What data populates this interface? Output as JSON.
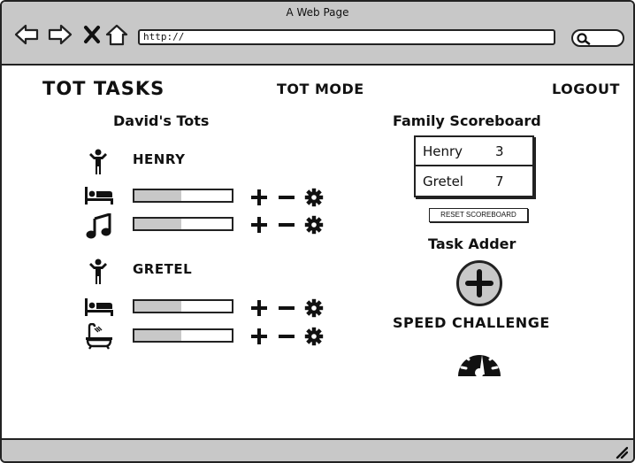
{
  "window": {
    "title": "A Web Page",
    "url": "http://"
  },
  "header": {
    "brand": "TOT TASKS",
    "mode_link": "TOT MODE",
    "logout_link": "LOGOUT"
  },
  "tots": {
    "title": "David's Tots",
    "kids": [
      {
        "name": "HENRY",
        "tasks": [
          {
            "icon": "bed-icon",
            "progress": 0.48
          },
          {
            "icon": "music-note-icon",
            "progress": 0.48
          }
        ]
      },
      {
        "name": "GRETEL",
        "tasks": [
          {
            "icon": "bed-icon",
            "progress": 0.48
          },
          {
            "icon": "bathtub-icon",
            "progress": 0.48
          }
        ]
      }
    ]
  },
  "scoreboard": {
    "title": "Family Scoreboard",
    "rows": [
      {
        "name": "Henry",
        "score": "3"
      },
      {
        "name": "Gretel",
        "score": "7"
      }
    ],
    "reset_label": "RESET SCOREBOARD"
  },
  "task_adder": {
    "title": "Task Adder"
  },
  "speed_challenge": {
    "title": "SPEED CHALLENGE"
  }
}
